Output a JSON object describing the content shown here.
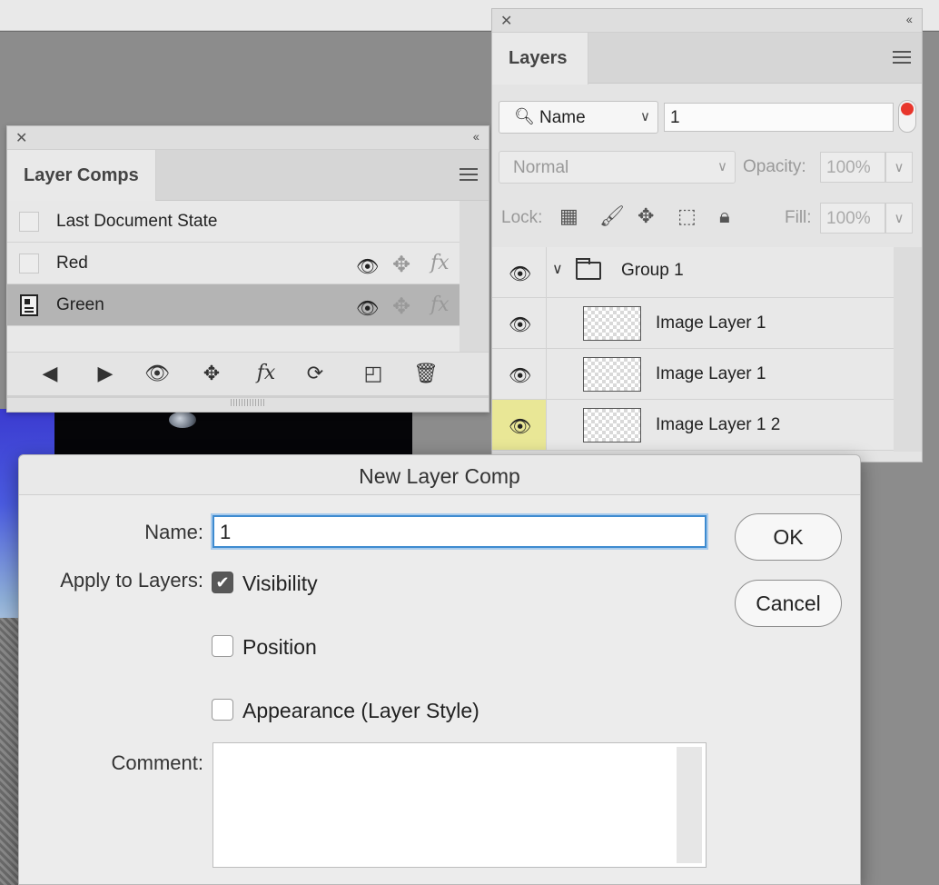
{
  "layer_comps_panel": {
    "title": "Layer Comps",
    "rows": [
      {
        "label": "Last Document State"
      },
      {
        "label": "Red"
      },
      {
        "label": "Green"
      }
    ]
  },
  "layers_panel": {
    "title": "Layers",
    "filter": {
      "kind": "Name",
      "value": "1"
    },
    "blend_mode": "Normal",
    "opacity_label": "Opacity:",
    "opacity_value": "100%",
    "lock_label": "Lock:",
    "fill_label": "Fill:",
    "fill_value": "100%",
    "layers": [
      {
        "name": "Group 1"
      },
      {
        "name": "Image Layer 1"
      },
      {
        "name": "Image Layer 1"
      },
      {
        "name": "Image Layer 1 2"
      }
    ]
  },
  "dialog": {
    "title": "New Layer Comp",
    "name_label": "Name:",
    "name_value": "1",
    "apply_label": "Apply to Layers:",
    "visibility_label": "Visibility",
    "visibility_checked": true,
    "position_label": "Position",
    "position_checked": false,
    "appearance_label": "Appearance (Layer Style)",
    "appearance_checked": false,
    "comment_label": "Comment:",
    "comment_value": "",
    "ok_label": "OK",
    "cancel_label": "Cancel"
  },
  "icons": {
    "close": "close-icon",
    "collapse": "collapse-icon",
    "menu": "panel-menu-icon",
    "eye": "eye-icon"
  },
  "colors": {
    "selected_row": "#b4b4b4",
    "visibility_highlight": "#e9e796",
    "focus_ring": "#3e8bd0",
    "filter_toggle": "#e8362c"
  }
}
